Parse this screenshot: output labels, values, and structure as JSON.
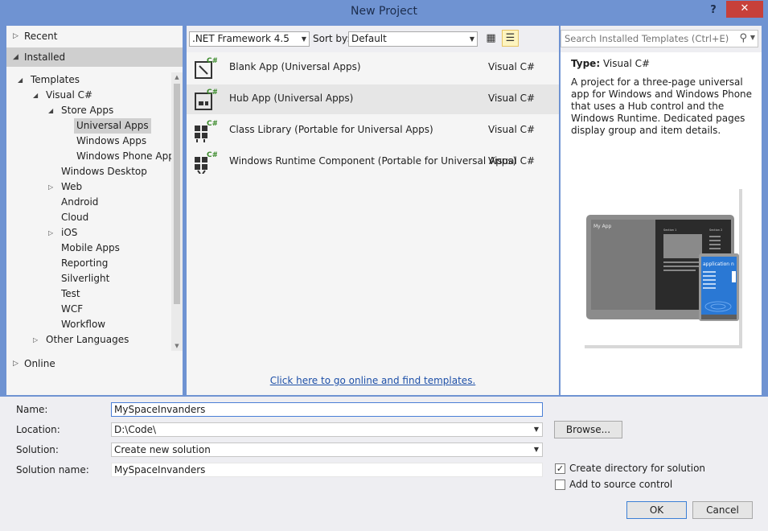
{
  "window": {
    "title": "New Project",
    "help_glyph": "?",
    "close_glyph": "✕"
  },
  "sidebar": {
    "recent": "Recent",
    "installed": "Installed",
    "online": "Online",
    "tree": [
      {
        "label": "Templates",
        "level": 1,
        "arrow": "◢",
        "selected": false
      },
      {
        "label": "Visual C#",
        "level": 2,
        "arrow": "◢",
        "selected": false
      },
      {
        "label": "Store Apps",
        "level": 3,
        "arrow": "◢",
        "selected": false
      },
      {
        "label": "Universal Apps",
        "level": 4,
        "arrow": "",
        "selected": true
      },
      {
        "label": "Windows Apps",
        "level": 4,
        "arrow": "",
        "selected": false
      },
      {
        "label": "Windows Phone Apps",
        "level": 4,
        "arrow": "",
        "selected": false
      },
      {
        "label": "Windows Desktop",
        "level": 3,
        "arrow": "",
        "selected": false
      },
      {
        "label": "Web",
        "level": 3,
        "arrow": "▷",
        "selected": false
      },
      {
        "label": "Android",
        "level": 3,
        "arrow": "",
        "selected": false
      },
      {
        "label": "Cloud",
        "level": 3,
        "arrow": "",
        "selected": false
      },
      {
        "label": "iOS",
        "level": 3,
        "arrow": "▷",
        "selected": false
      },
      {
        "label": "Mobile Apps",
        "level": 3,
        "arrow": "",
        "selected": false
      },
      {
        "label": "Reporting",
        "level": 3,
        "arrow": "",
        "selected": false
      },
      {
        "label": "Silverlight",
        "level": 3,
        "arrow": "",
        "selected": false
      },
      {
        "label": "Test",
        "level": 3,
        "arrow": "",
        "selected": false
      },
      {
        "label": "WCF",
        "level": 3,
        "arrow": "",
        "selected": false
      },
      {
        "label": "Workflow",
        "level": 3,
        "arrow": "",
        "selected": false
      },
      {
        "label": "Other Languages",
        "level": 2,
        "arrow": "▷",
        "selected": false
      }
    ]
  },
  "toolbar": {
    "framework": ".NET Framework 4.5",
    "sort_by_label": "Sort by:",
    "sort_by_value": "Default"
  },
  "search": {
    "placeholder": "Search Installed Templates (Ctrl+E)"
  },
  "templates": [
    {
      "name": "Blank App (Universal Apps)",
      "lang": "Visual C#",
      "icon": "blank-app-icon",
      "selected": false
    },
    {
      "name": "Hub App (Universal Apps)",
      "lang": "Visual C#",
      "icon": "hub-app-icon",
      "selected": true
    },
    {
      "name": "Class Library (Portable for Universal Apps)",
      "lang": "Visual C#",
      "icon": "class-library-icon",
      "selected": false
    },
    {
      "name": "Windows Runtime Component (Portable for Universal Apps)",
      "lang": "Visual C#",
      "icon": "runtime-component-icon",
      "selected": false
    }
  ],
  "online_link": "Click here to go online and find templates.",
  "description": {
    "type_label": "Type:",
    "type_value": "Visual C#",
    "text": "A project for a three-page universal app for Windows and Windows Phone that uses a Hub control and the Windows Runtime. Dedicated pages display group and item details.",
    "preview": {
      "app_title": "My App",
      "section1": "Section 1",
      "section2": "Section 2",
      "phone_title": "application n"
    }
  },
  "form": {
    "name_label": "Name:",
    "name_value": "MySpaceInvanders",
    "location_label": "Location:",
    "location_value": "D:\\Code\\",
    "solution_label": "Solution:",
    "solution_value": "Create new solution",
    "solution_name_label": "Solution name:",
    "solution_name_value": "MySpaceInvanders",
    "browse": "Browse...",
    "create_dir": "Create directory for solution",
    "create_dir_checked": true,
    "add_source": "Add to source control",
    "add_source_checked": false,
    "ok": "OK",
    "cancel": "Cancel"
  },
  "colors": {
    "window_frame": "#6f93d2",
    "close_button": "#c7403a",
    "link": "#1e50a8",
    "selection": "#cfcfcf"
  }
}
